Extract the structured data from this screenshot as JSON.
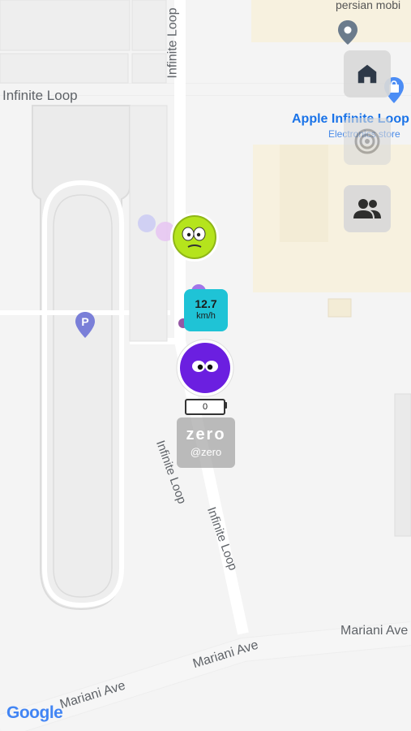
{
  "map": {
    "street_labels": [
      {
        "id": "infinite-loop-top-left",
        "text": "Infinite Loop"
      },
      {
        "id": "infinite-loop-vertical",
        "text": "Infinite Loop"
      },
      {
        "id": "infinite-loop-south-1",
        "text": "Infinite Loop"
      },
      {
        "id": "infinite-loop-south-2",
        "text": "Infinite Loop"
      },
      {
        "id": "mariani-ave-1",
        "text": "Mariani Ave"
      },
      {
        "id": "mariani-ave-2",
        "text": "Mariani Ave"
      },
      {
        "id": "mariani-ave-3",
        "text": "Mariani Ave"
      }
    ],
    "poi_top": "persian mobi",
    "poi_store": {
      "title": "Apple Infinite Loop",
      "subtitle": "Electronics store"
    },
    "parking_icon": "parking-icon",
    "attribution": "Google"
  },
  "side_controls": [
    {
      "id": "home",
      "icon": "home-icon"
    },
    {
      "id": "locate",
      "icon": "target-icon"
    },
    {
      "id": "friends",
      "icon": "people-icon"
    }
  ],
  "friend_avatar": {
    "color": "#b5e41c",
    "icon": "face-icon"
  },
  "self_avatar": {
    "color": "#6b1fe0",
    "icon": "face-icon"
  },
  "speed": {
    "value": "12.7",
    "unit": "km/h"
  },
  "battery": {
    "value": "0"
  },
  "user": {
    "name": "zero",
    "handle": "@zero"
  },
  "colors": {
    "map_bg": "#f4f4f4",
    "road": "#ffffff",
    "building": "#f7f1df",
    "poi_blue": "#1a73e8",
    "speed_badge": "#1fc3d6"
  }
}
